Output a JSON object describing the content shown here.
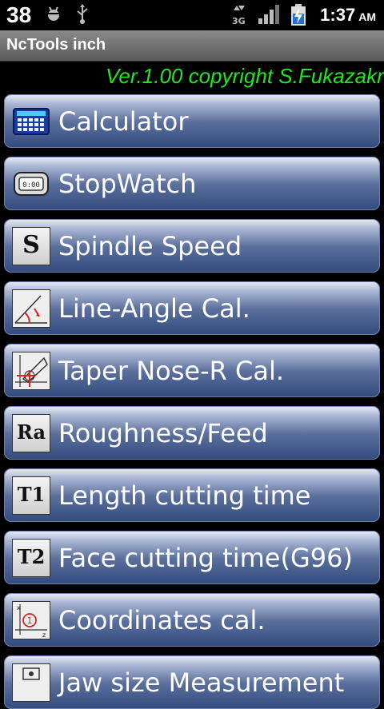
{
  "status_bar": {
    "notification_count": "38",
    "network": "3G",
    "time": "1:37",
    "ampm": "AM"
  },
  "app": {
    "title": "NcTools inch"
  },
  "version_text": "Ver.1.00 copyright S.Fukazakr",
  "menu": [
    {
      "label": "Calculator",
      "icon": "calculator-icon"
    },
    {
      "label": "StopWatch",
      "icon": "stopwatch-icon"
    },
    {
      "label": "Spindle Speed",
      "icon": "S",
      "icon_name": "spindle-speed-icon"
    },
    {
      "label": "Line-Angle Cal.",
      "icon": "line-angle-icon"
    },
    {
      "label": "Taper Nose-R Cal.",
      "icon": "taper-nose-icon"
    },
    {
      "label": "Roughness/Feed",
      "icon": "Ra",
      "icon_name": "roughness-icon"
    },
    {
      "label": "Length cutting time",
      "icon": "T1",
      "icon_name": "length-time-icon"
    },
    {
      "label": "Face cutting time(G96)",
      "icon": "T2",
      "icon_name": "face-time-icon"
    },
    {
      "label": "Coordinates cal.",
      "icon": "coordinates-icon"
    },
    {
      "label": "Jaw size Measurement",
      "icon": "jaw-size-icon"
    }
  ],
  "colors": {
    "accent": "#1fe61f",
    "button_dark": "#324a7d"
  }
}
